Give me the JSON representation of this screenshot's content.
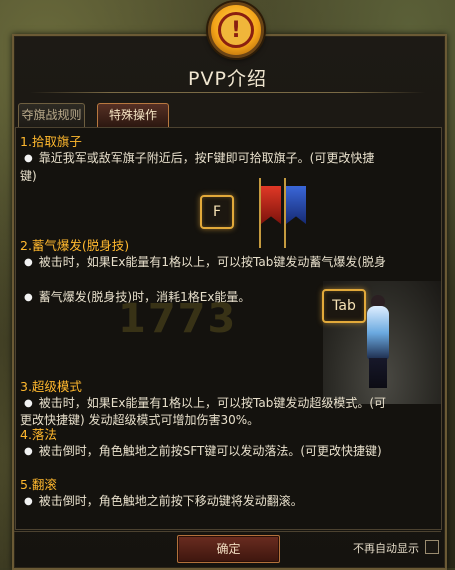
{
  "dialog": {
    "title": "PVP介绍"
  },
  "tabs": [
    {
      "label": "夺旗战规则",
      "active": false
    },
    {
      "label": "特殊操作",
      "active": true
    }
  ],
  "sections": [
    {
      "heading": "1.拾取旗子",
      "lines": [
        "靠近我军或敌军旗子附近后，按F键即可拾取旗子。(可更改快捷",
        "键)"
      ]
    },
    {
      "heading": "2.蓄气爆发(脱身技)",
      "lines": [
        "被击时，如果Ex能量有1格以上，可以按Tab键发动蓄气爆发(脱身",
        "蓄气爆发(脱身技)时，消耗1格Ex能量。"
      ]
    },
    {
      "heading": "3.超级模式",
      "lines": [
        "被击时，如果Ex能量有1格以上，可以按Tab键发动超级模式。(可",
        "更改快捷键) 发动超级模式可增加伤害30%。"
      ]
    },
    {
      "heading": "4.落法",
      "lines": [
        "被击倒时，角色触地之前按SFT键可以发动落法。(可更改快捷键)"
      ]
    },
    {
      "heading": "5.翻滚",
      "lines": [
        "被击倒时，角色触地之前按下移动键将发动翻滚。"
      ]
    }
  ],
  "keys": {
    "f_key": "F",
    "tab_key": "Tab"
  },
  "footer": {
    "confirm_label": "确定",
    "dont_show_label": "不再自动显示",
    "dont_show_checked": false
  },
  "colors": {
    "heading": "#ffb82e",
    "body_text": "#e8e0cc",
    "key_glow": "#e2a93a",
    "alert": "#f4a419"
  },
  "icons": [
    "alert-icon",
    "red-flag-icon",
    "blue-flag-icon",
    "character-illustration"
  ]
}
